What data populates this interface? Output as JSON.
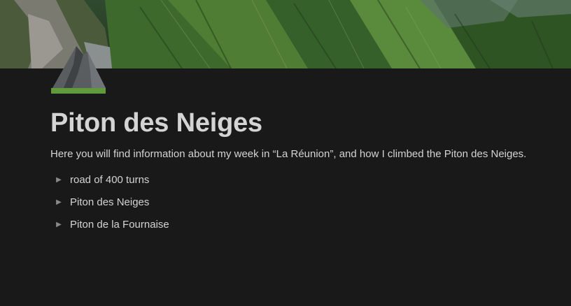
{
  "page": {
    "title": "Piton des Neiges",
    "description": "Here you will find information about my week in “La Réunion”, and how I climbed the Piton des Neiges."
  },
  "toggles": [
    {
      "label": "road of 400 turns",
      "icon": "triangle-right-icon"
    },
    {
      "label": "Piton des Neiges",
      "icon": "triangle-right-icon"
    },
    {
      "label": "Piton de la Fournaise",
      "icon": "triangle-right-icon"
    }
  ],
  "cover": {
    "icon": "mountain-landscape-cover"
  },
  "page_icon": {
    "icon": "mountain-icon"
  },
  "colors": {
    "background": "#191919",
    "text": "#d4d4d4",
    "muted": "#8a8a8a"
  }
}
